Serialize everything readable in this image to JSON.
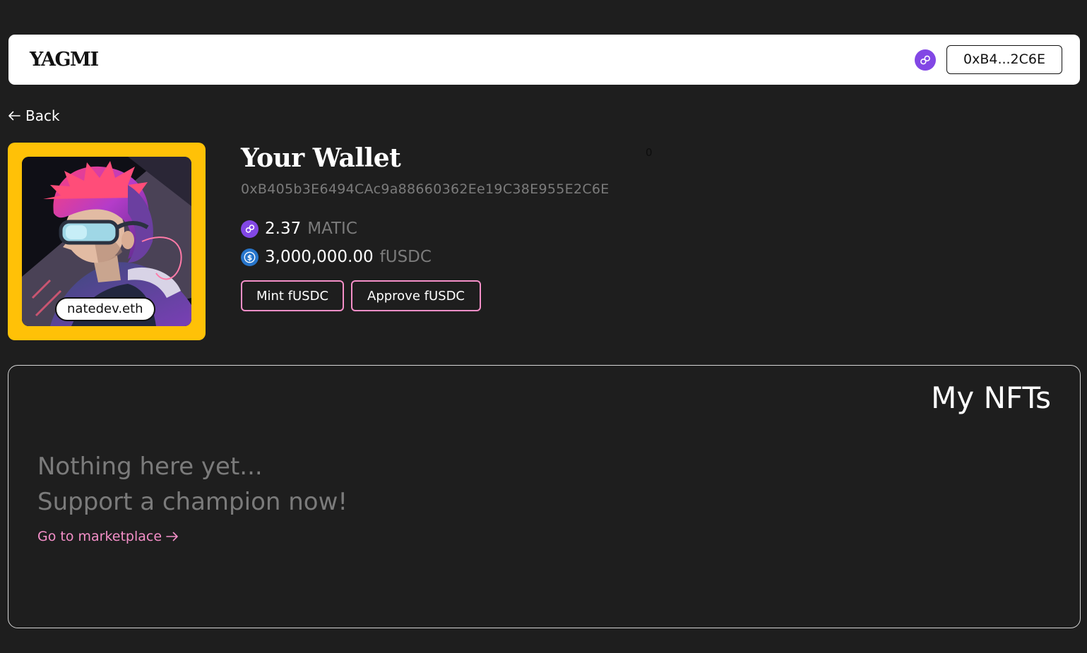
{
  "navbar": {
    "logo": "YAGMI",
    "network_icon": "polygon-icon",
    "wallet_short": "0xB4...2C6E"
  },
  "back": {
    "label": "Back",
    "icon": "arrow-left-icon"
  },
  "profile": {
    "ens_name": "natedev.eth",
    "frame_color": "#FFC107",
    "avatar": "illustrated-portrait-with-goggles"
  },
  "wallet": {
    "title": "Your Wallet",
    "stray_count": "0",
    "address": "0xB405b3E6494CAc9a88660362Ee19C38E955E2C6E",
    "balances": [
      {
        "icon": "polygon-icon",
        "value": "2.37",
        "unit": "MATIC"
      },
      {
        "icon": "usdc-icon",
        "value": "3,000,000.00",
        "unit": "fUSDC"
      }
    ],
    "actions": {
      "mint_label": "Mint fUSDC",
      "approve_label": "Approve fUSDC"
    }
  },
  "nfts": {
    "title": "My NFTs",
    "empty_line1": "Nothing here yet...",
    "empty_line2": "Support a champion now!",
    "link_label": "Go to marketplace",
    "link_icon": "arrow-right-icon"
  },
  "colors": {
    "background": "#1E1E1E",
    "accent_pink": "#F48FC8",
    "polygon_purple": "#8247E5",
    "usdc_blue": "#2775CA",
    "muted_text": "#7B7B7B"
  }
}
